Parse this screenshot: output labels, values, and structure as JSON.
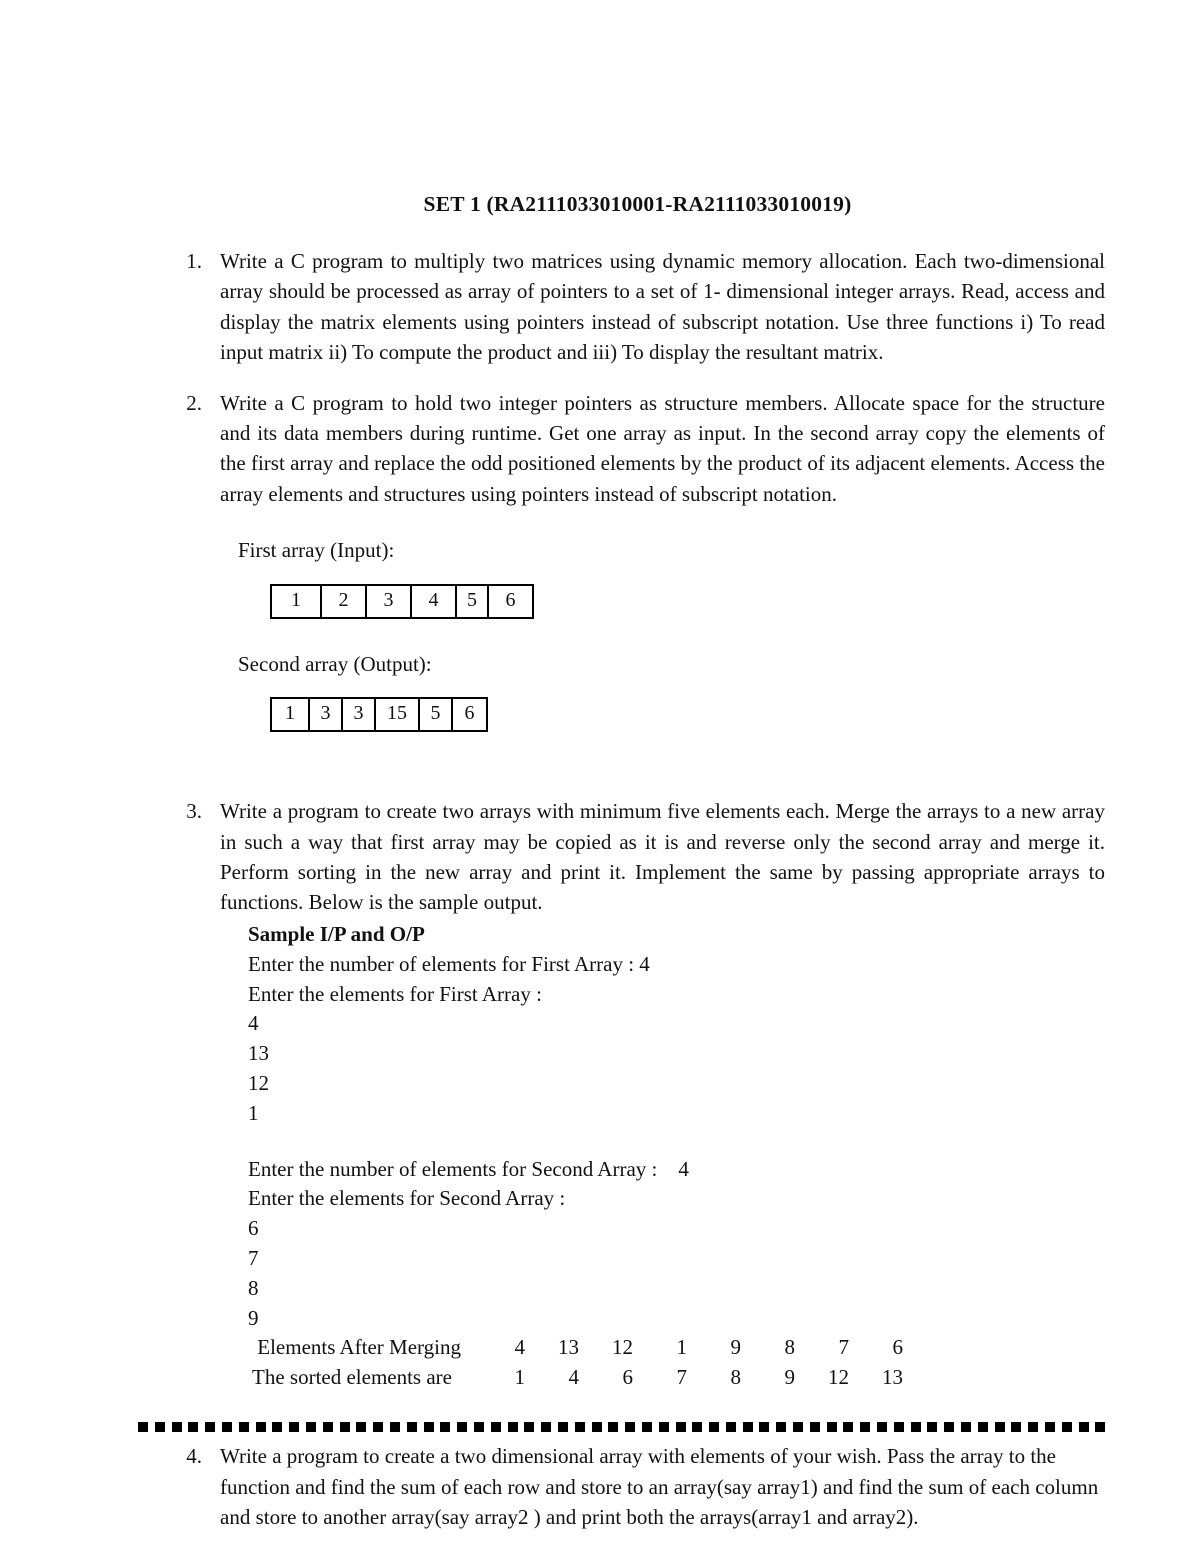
{
  "document": {
    "title": "SET 1 (RA2111033010001-RA2111033010019)"
  },
  "questions": [
    {
      "number": "1.",
      "text": "Write a C program to multiply two matrices using dynamic memory allocation. Each two-dimensional array should be processed as array of pointers to a set of 1- dimensional integer arrays. Read, access and display the matrix elements using pointers instead of subscript notation. Use three functions i) To read input matrix ii) To compute the product and iii) To display the resultant matrix."
    },
    {
      "number": "2.",
      "text": "Write a C program to hold two integer pointers as structure members. Allocate space for the structure and its data members during runtime. Get one array as input. In the second array copy the elements of the first array and replace the odd positioned elements by the product of its adjacent elements. Access the array elements and structures using pointers instead of subscript notation."
    },
    {
      "number": "3.",
      "text": "Write a program to create two arrays with minimum five elements each. Merge the arrays to a new array in such a way that first array may be copied as it is and reverse only the second array and merge it. Perform sorting in the new array and print it. Implement the same by passing appropriate arrays to functions. Below is the sample output."
    },
    {
      "number": "4.",
      "text": "Write a program to create a two dimensional array with elements of your wish. Pass the array to the function and find the sum of each row and store to an array(say array1) and find the sum of each column and store to another array(say array2 ) and print both the arrays(array1 and array2)."
    }
  ],
  "arrays": {
    "first": {
      "caption": "First array (Input):",
      "cells": [
        "1",
        "2",
        "3",
        "4",
        "5",
        "6"
      ],
      "widths": [
        50,
        45,
        45,
        45,
        32,
        43
      ]
    },
    "second": {
      "caption": "Second array (Output):",
      "cells": [
        "1",
        "3",
        "3",
        "15",
        "5",
        "6"
      ],
      "widths": [
        38,
        33,
        33,
        44,
        33,
        33
      ]
    }
  },
  "sample": {
    "heading": "Sample I/P and O/P",
    "lines_first": [
      "Enter the number of elements for First Array : 4",
      "Enter the elements for First Array :",
      "4",
      "13",
      "12",
      "1"
    ],
    "lines_second": [
      "Enter the number of elements for Second Array :    4",
      "Enter the elements for Second Array :",
      "6",
      "7",
      "8",
      "9"
    ],
    "output_rows": [
      {
        "label": " Elements After Merging",
        "values": [
          "4",
          "13",
          "12",
          "1",
          "9",
          "8",
          "7",
          "6"
        ]
      },
      {
        "label": "The sorted elements are",
        "values": [
          "1",
          "4",
          "6",
          "7",
          "8",
          "9",
          "12",
          "13"
        ]
      }
    ]
  },
  "footer": {
    "dot_count": 58
  }
}
